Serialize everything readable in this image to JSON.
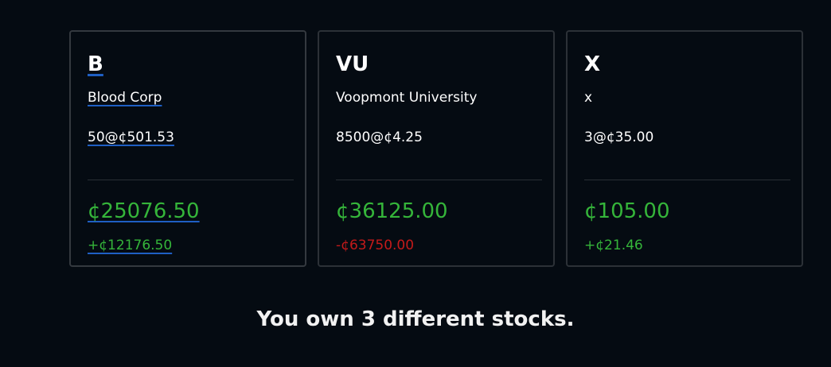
{
  "currency_symbol": "¢",
  "stocks": [
    {
      "ticker": "B",
      "company": "Blood Corp",
      "holding": "50@¢501.53",
      "value": "¢25076.50",
      "change": "+¢12176.50",
      "change_direction": "gain",
      "selected": true
    },
    {
      "ticker": "VU",
      "company": "Voopmont University",
      "holding": "8500@¢4.25",
      "value": "¢36125.00",
      "change": "-¢63750.00",
      "change_direction": "loss",
      "selected": false
    },
    {
      "ticker": "X",
      "company": "x",
      "holding": "3@¢35.00",
      "value": "¢105.00",
      "change": "+¢21.46",
      "change_direction": "gain",
      "selected": false
    }
  ],
  "summary": "You own 3 different stocks.",
  "colors": {
    "background": "#050b12",
    "card_border": "#2c3137",
    "gain": "#35b53a",
    "loss": "#c41a1a",
    "selection_underline": "#1f5fc4"
  }
}
